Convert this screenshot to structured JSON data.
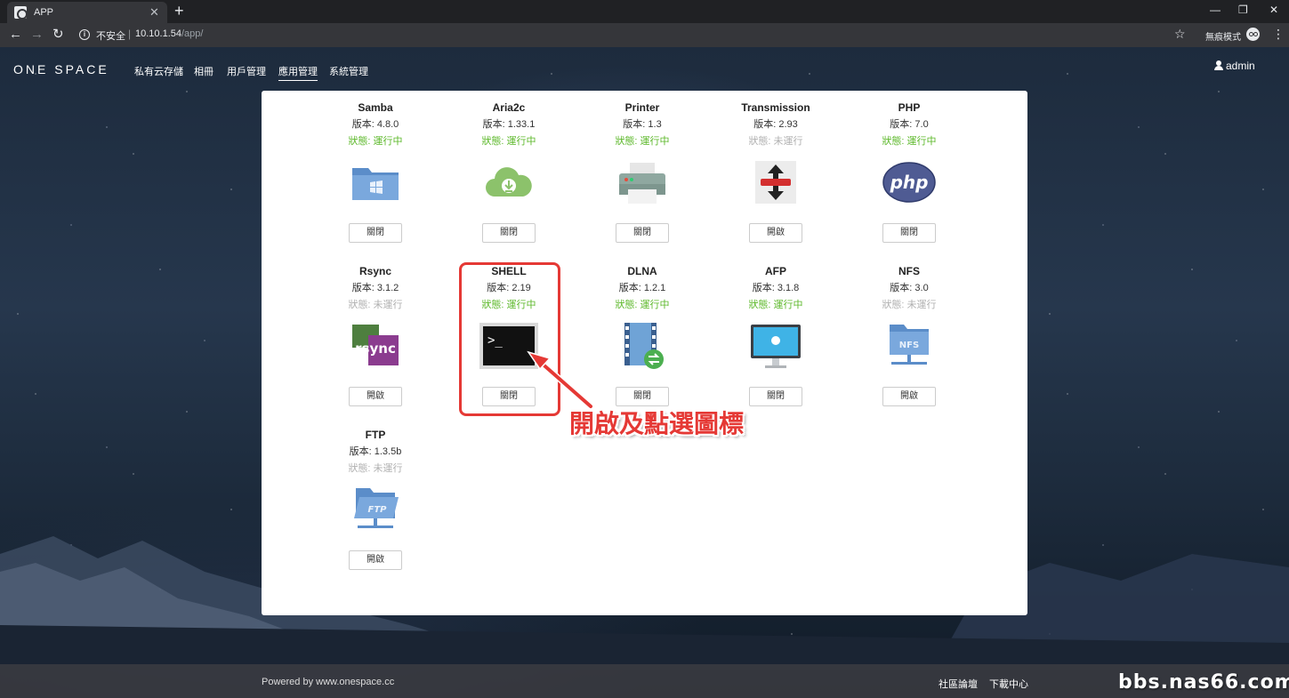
{
  "browser": {
    "tab_title": "APP",
    "tab_close": "✕",
    "new_tab": "+",
    "insecure_label": "不安全",
    "url_host": "10.10.1.54",
    "url_path": "/app/",
    "incognito_label": "無痕模式",
    "window_controls": [
      "—",
      "❐",
      "✕"
    ]
  },
  "nav": {
    "brand": "ONE SPACE",
    "items": [
      "私有云存儲",
      "相冊",
      "用戶管理",
      "應用管理",
      "系統管理"
    ],
    "active": "應用管理",
    "user": "admin"
  },
  "apps": [
    {
      "name": "Samba",
      "version": "版本: 4.8.0",
      "status": "狀態: 運行中",
      "running": true,
      "button": "關閉",
      "icon": "folder-windows-icon"
    },
    {
      "name": "Aria2c",
      "version": "版本: 1.33.1",
      "status": "狀態: 運行中",
      "running": true,
      "button": "關閉",
      "icon": "cloud-download-icon"
    },
    {
      "name": "Printer",
      "version": "版本: 1.3",
      "status": "狀態: 運行中",
      "running": true,
      "button": "關閉",
      "icon": "printer-icon"
    },
    {
      "name": "Transmission",
      "version": "版本: 2.93",
      "status": "狀態: 未運行",
      "running": false,
      "button": "開啟",
      "icon": "transmission-icon"
    },
    {
      "name": "PHP",
      "version": "版本: 7.0",
      "status": "狀態: 運行中",
      "running": true,
      "button": "關閉",
      "icon": "php-icon"
    },
    {
      "name": "Rsync",
      "version": "版本: 3.1.2",
      "status": "狀態: 未運行",
      "running": false,
      "button": "開啟",
      "icon": "rsync-icon"
    },
    {
      "name": "SHELL",
      "version": "版本: 2.19",
      "status": "狀態: 運行中",
      "running": true,
      "button": "關閉",
      "icon": "terminal-icon"
    },
    {
      "name": "DLNA",
      "version": "版本: 1.2.1",
      "status": "狀態: 運行中",
      "running": true,
      "button": "關閉",
      "icon": "film-share-icon"
    },
    {
      "name": "AFP",
      "version": "版本: 3.1.8",
      "status": "狀態: 運行中",
      "running": true,
      "button": "關閉",
      "icon": "imac-icon"
    },
    {
      "name": "NFS",
      "version": "版本: 3.0",
      "status": "狀態: 未運行",
      "running": false,
      "button": "開啟",
      "icon": "nfs-folder-icon"
    },
    {
      "name": "FTP",
      "version": "版本: 1.3.5b",
      "status": "狀態: 未運行",
      "running": false,
      "button": "開啟",
      "icon": "ftp-folder-icon"
    }
  ],
  "annotation": "開啟及點選圖標",
  "footer": {
    "powered": "Powered by www.onespace.cc",
    "links": [
      "社區論壇",
      "下載中心"
    ],
    "watermark": "bbs.nas66.com"
  },
  "colors": {
    "running": "#5cb82a",
    "stopped": "#b0b0b0",
    "highlight": "#e53935"
  }
}
